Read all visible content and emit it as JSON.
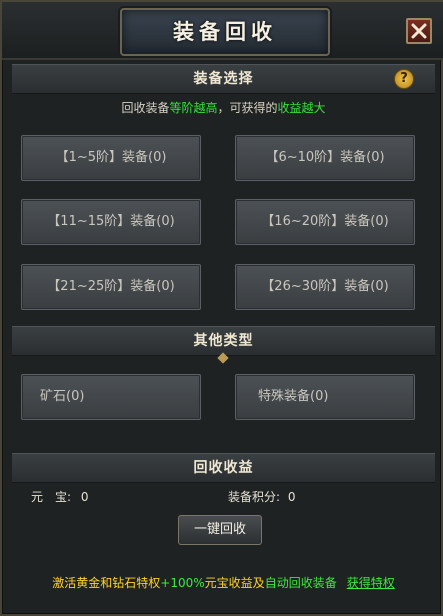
{
  "window": {
    "title": "装备回收"
  },
  "sections": {
    "equipment": "装备选择",
    "other": "其他类型",
    "income": "回收收益"
  },
  "hint": {
    "p1": "回收装备",
    "p2": "等阶越高",
    "p3": "，可获得的",
    "p4": "收益越大"
  },
  "equipment_buttons": [
    "【1~5阶】装备(0)",
    "【6~10阶】装备(0)",
    "【11~15阶】装备(0)",
    "【16~20阶】装备(0)",
    "【21~25阶】装备(0)",
    "【26~30阶】装备(0)"
  ],
  "other_buttons": [
    "矿石(0)",
    "特殊装备(0)"
  ],
  "income": {
    "yuanbao_label": "元　宝:",
    "yuanbao_value": "0",
    "points_label": "装备积分:",
    "points_value": "0"
  },
  "actions": {
    "one_key_recycle": "一键回收"
  },
  "footer": {
    "p1": "激活黄金和钻石特权",
    "p2": "+100%",
    "p3": "元宝收益及",
    "p4": "自动回收装备",
    "link": "获得特权"
  },
  "icons": {
    "close": "close-icon",
    "help": "help-icon"
  },
  "colors": {
    "highlight_green": "#34e23a",
    "footer_yellow": "#ffd32a"
  }
}
